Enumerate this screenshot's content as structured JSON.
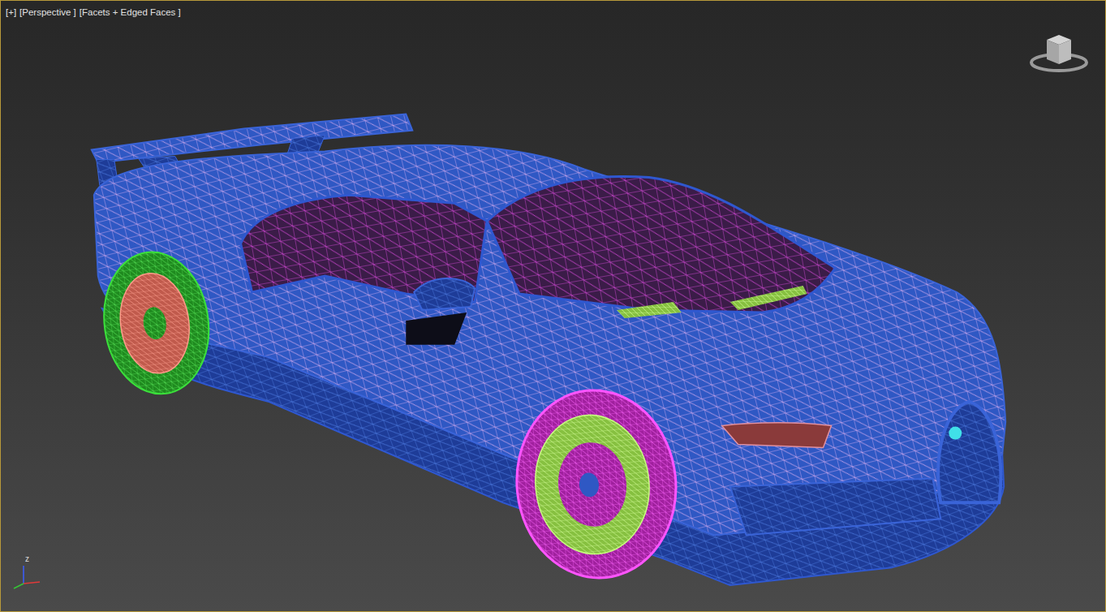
{
  "viewport": {
    "active": true,
    "labels": [
      "[+]",
      "[Perspective ]",
      "[Facets + Edged Faces ]"
    ]
  },
  "axis_tripod": {
    "label": "z"
  }
}
